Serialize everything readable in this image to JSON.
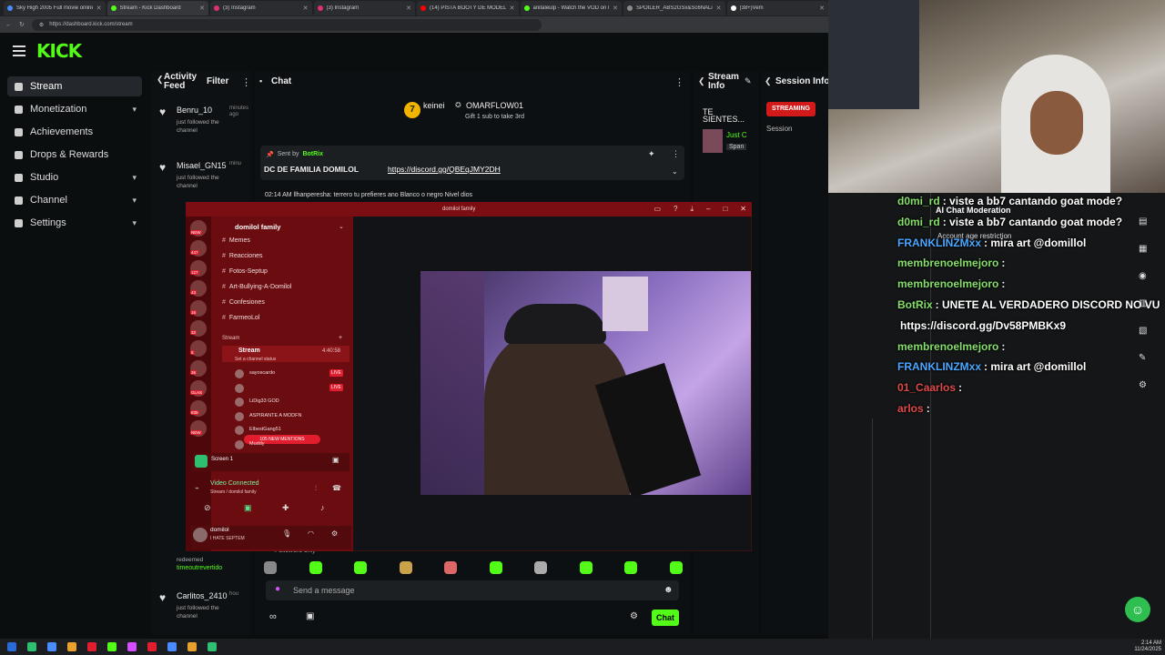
{
  "browser": {
    "tabs": [
      {
        "title": "Sky High 2005 Full movie online",
        "color": "#4a8cff"
      },
      {
        "title": "Stream - Kick Dashboard",
        "color": "#53fc18"
      },
      {
        "title": "(3) Instagram",
        "color": "#e1306c"
      },
      {
        "title": "(3) Instagram",
        "color": "#e1306c"
      },
      {
        "title": "(14) PISTA BOOTY DE MODELO",
        "color": "#ff0000"
      },
      {
        "title": "anitaleulp - Watch the VOD on Ki",
        "color": "#53fc18"
      },
      {
        "title": "SPOILER_ABS2GSx&Sc6ÑALiOr",
        "color": "#8a8a8a"
      },
      {
        "title": "(38+)Vem",
        "color": "#ffffff"
      }
    ],
    "url": "https://dashboard.kick.com/stream"
  },
  "brand": {
    "logo": "KICK",
    "color": "#53fc18"
  },
  "sidebar": {
    "items": [
      {
        "label": "Stream",
        "chev": ""
      },
      {
        "label": "Monetization",
        "chev": "▾"
      },
      {
        "label": "Achievements",
        "chev": ""
      },
      {
        "label": "Drops & Rewards",
        "chev": ""
      },
      {
        "label": "Studio",
        "chev": "▾"
      },
      {
        "label": "Channel",
        "chev": "▾"
      },
      {
        "label": "Settings",
        "chev": "▾"
      }
    ]
  },
  "activity": {
    "title": "Activity Feed",
    "filter": "Filter",
    "items": [
      {
        "name": "Benru_10",
        "time": "minutes ago",
        "desc": "just followed the channel"
      },
      {
        "name": "Misael_GN15",
        "time": "minu",
        "desc": "just followed the channel"
      },
      {
        "name": "Carlitos_2410",
        "time": "hou",
        "desc": "just followed the channel"
      }
    ],
    "redeem": {
      "line1": "redeemed",
      "line2": "timeoutrevertido"
    }
  },
  "chat": {
    "title": "Chat",
    "gift": {
      "user1": "keinei",
      "user2": "OMARFLOW01",
      "count": "7",
      "text": "Gift 1 sub to take 3rd"
    },
    "pinned": {
      "sent_by": "Sent by",
      "bot": "BotRix",
      "text": "DC DE FAMILIA DOMILOL",
      "link": "https://discord.gg/QBEqJMY2DH"
    },
    "message": "02:14 AM llhanperesha: terrero tu prefieres ano Blanco o negro Nivel dios",
    "followers_only": "Followers only",
    "placeholder": "Send a message",
    "send": "Chat"
  },
  "stream_info": {
    "title": "Stream Info",
    "line1": "TE",
    "line2": "SIENTES...",
    "tag1": "Just C",
    "tag2": "Span"
  },
  "session_info": {
    "title": "Session Info",
    "badge": "STREAMING",
    "label": "Session"
  },
  "discord": {
    "title": "domilol family",
    "server": "domilol family",
    "channels": [
      "Memes",
      "Reacciones",
      "Fotos-Septup",
      "Art-Bullying-A-Domilol",
      "Confesiones",
      "FarmeoLol"
    ],
    "category": "Stream",
    "stream_channel": "Stream",
    "stream_time": "4:40:58",
    "status_hint": "Set a channel status",
    "users": [
      {
        "name": "sayoscardo",
        "live": "LIVE"
      },
      {
        "name": "",
        "live": "LIVE"
      },
      {
        "name": "LiDig33 GOD",
        "live": ""
      },
      {
        "name": "ASPIRANTE A MODFN",
        "live": ""
      },
      {
        "name": "ElbestGang51",
        "live": ""
      },
      {
        "name": "Muddy",
        "live": ""
      }
    ],
    "mentions": "105 NEW MENTIONS",
    "screen": "Screen 1",
    "video_connected": "Video Connected",
    "voice_channel": "Stream / domilol family",
    "me": "domilol",
    "me_status": "I HATE SEPTEM",
    "badges": [
      "NEW",
      "447",
      "127",
      "43",
      "16",
      "32",
      "5",
      "36",
      "GLAS",
      "835",
      "NEW"
    ]
  },
  "overlay_chat": {
    "lines": [
      {
        "user": "d0mi_rd",
        "text": ": viste a bb7 cantando goat mode?",
        "color": "#86e06a"
      },
      {
        "user": "d0mi_rd",
        "text": ": viste a bb7 cantando goat mode?",
        "color": "#86e06a"
      },
      {
        "user": "FRANKLINZMxx",
        "text": ": mira art @domillol",
        "color": "#4aa8ff"
      },
      {
        "user": "membrenoelmejoro",
        "text": ":",
        "color": "#86e06a"
      },
      {
        "user": "membrenoelmejoro",
        "text": ":",
        "color": "#86e06a"
      },
      {
        "user": "BotRix",
        "text": ": UNETE AL VERDADERO DISCORD NO VU",
        "color": "#86e06a"
      },
      {
        "user": "",
        "text": "https://discord.gg/Dv58PMBKx9",
        "color": "#ffffff"
      },
      {
        "user": "membrenoelmejoro",
        "text": ":",
        "color": "#86e06a"
      },
      {
        "user": "FRANKLINZMxx",
        "text": ": mira art @domillol",
        "color": "#4aa8ff"
      },
      {
        "user": "01_Caarlos",
        "text": ":",
        "color": "#e04a4a"
      },
      {
        "user": "arlos",
        "text": ":",
        "color": "#e04a4a"
      }
    ],
    "mod_popup": {
      "title": "AI Chat Moderation",
      "sub": "Account age restriction"
    }
  },
  "taskbar": {
    "time": "2:14 AM",
    "date": "11/24/2025"
  }
}
